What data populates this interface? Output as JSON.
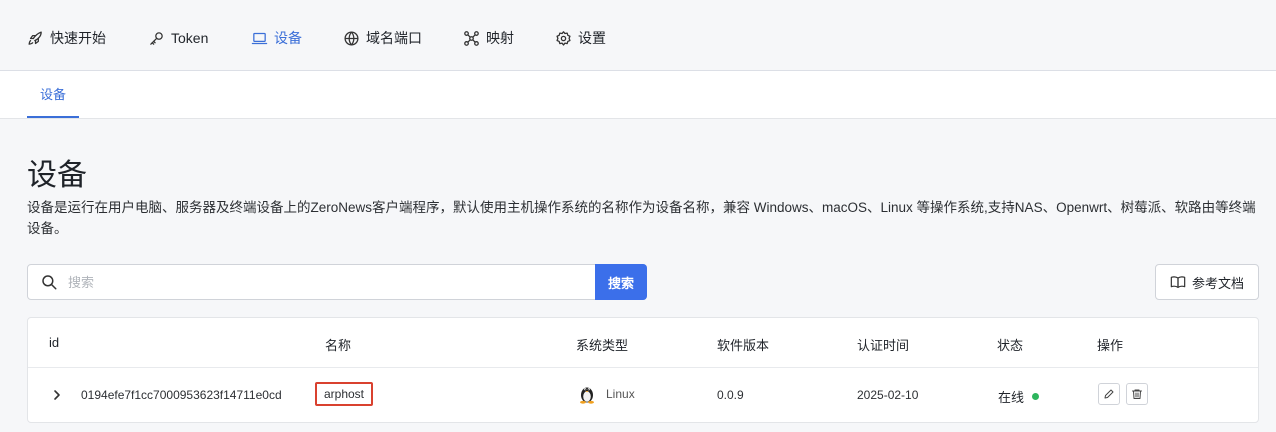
{
  "nav": {
    "items": [
      {
        "label": "快速开始",
        "icon": "rocket-icon"
      },
      {
        "label": "Token",
        "icon": "key-icon"
      },
      {
        "label": "设备",
        "icon": "laptop-icon",
        "active": true
      },
      {
        "label": "域名端口",
        "icon": "globe-icon"
      },
      {
        "label": "映射",
        "icon": "network-icon"
      },
      {
        "label": "设置",
        "icon": "gear-icon"
      }
    ]
  },
  "subnav": {
    "tab": "设备"
  },
  "page": {
    "title": "设备",
    "description": "设备是运行在用户电脑、服务器及终端设备上的ZeroNews客户端程序，默认使用主机操作系统的名称作为设备名称，兼容 Windows、macOS、Linux 等操作系统,支持NAS、Openwrt、树莓派、软路由等终端设备。"
  },
  "search": {
    "placeholder": "搜索",
    "value": "",
    "button": "搜索"
  },
  "docs_button": "参考文档",
  "table": {
    "headers": [
      "id",
      "名称",
      "系统类型",
      "软件版本",
      "认证时间",
      "状态",
      "操作"
    ],
    "rows": [
      {
        "id": "0194efe7f1cc7000953623f14711e0cd",
        "name": "arphost",
        "os": "Linux",
        "version": "0.0.9",
        "auth_time": "2025-02-10",
        "status": "在线"
      }
    ]
  },
  "colors": {
    "accent": "#3b6fea",
    "online": "#2db55d",
    "highlight": "#d9412f"
  }
}
